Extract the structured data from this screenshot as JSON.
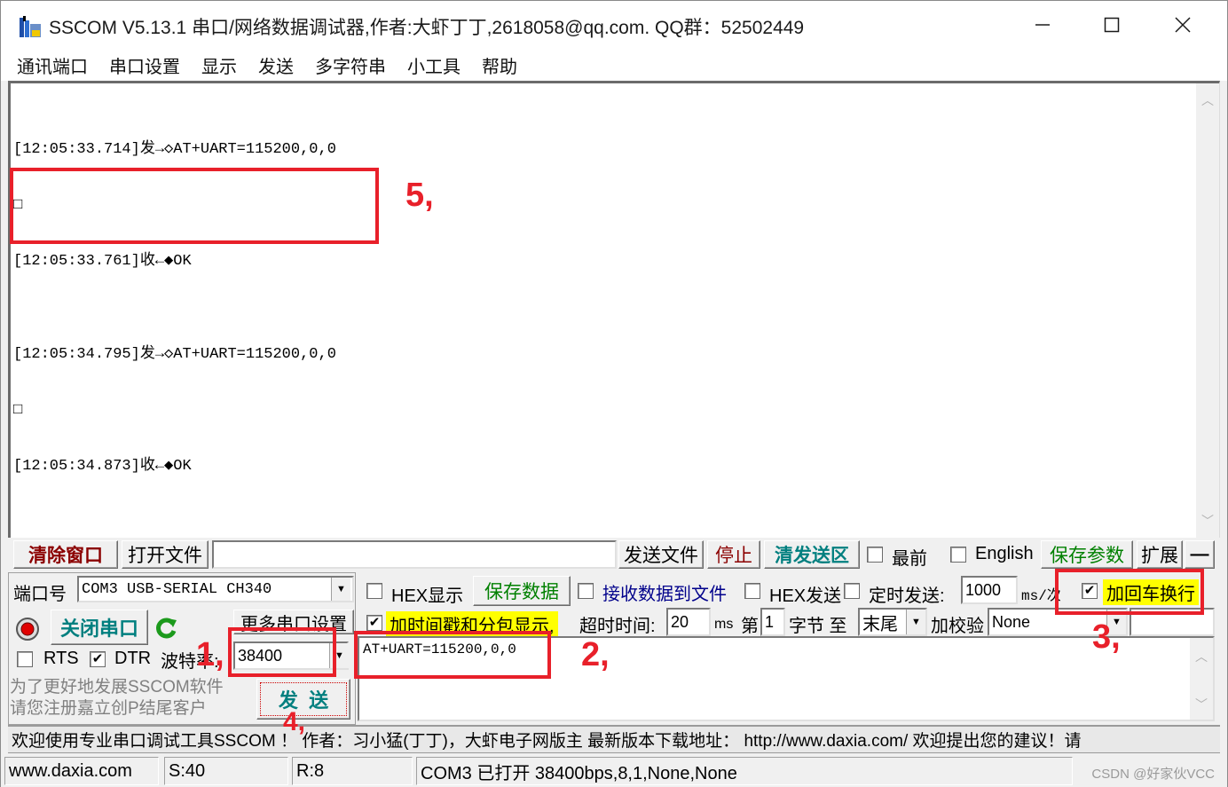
{
  "window": {
    "title": "SSCOM V5.13.1 串口/网络数据调试器,作者:大虾丁丁,2618058@qq.com. QQ群：52502449",
    "controls": {
      "minimize": "—",
      "maximize": "☐",
      "close": "✕"
    }
  },
  "menubar": {
    "items": [
      "通讯端口",
      "串口设置",
      "显示",
      "发送",
      "多字符串",
      "小工具",
      "帮助"
    ]
  },
  "receive": {
    "lines": [
      "[12:05:33.714]发→◇AT+UART=115200,0,0",
      "□",
      "[12:05:33.761]收←◆OK",
      "",
      "[12:05:34.795]发→◇AT+UART=115200,0,0",
      "□",
      "[12:05:34.873]收←◆OK"
    ]
  },
  "toolbar": {
    "clear_window": "清除窗口",
    "open_file": "打开文件",
    "file_path": "",
    "send_file": "发送文件",
    "stop": "停止",
    "clear_send": "清发送区",
    "topmost": "最前",
    "topmost_checked": false,
    "english": "English",
    "english_checked": false,
    "save_params": "保存参数",
    "expand": "扩展",
    "collapse": "—"
  },
  "port": {
    "port_label": "端口号",
    "port_value": "COM3 USB-SERIAL CH340",
    "close_port": "关闭串口",
    "more_settings": "更多串口设置",
    "rts_label": "RTS",
    "rts_checked": false,
    "dtr_label": "DTR",
    "dtr_checked": true,
    "baud_label": "波特率:",
    "baud_value": "38400",
    "promo_line1": "为了更好地发展SSCOM软件",
    "promo_line2": "请您注册嘉立创P结尾客户",
    "send_button": "发  送"
  },
  "options": {
    "hex_display": "HEX显示",
    "hex_display_checked": false,
    "save_data": "保存数据",
    "recv_to_file": "接收数据到文件",
    "recv_to_file_checked": false,
    "hex_send": "HEX发送",
    "hex_send_checked": false,
    "timed_send": "定时发送:",
    "timed_send_checked": false,
    "interval_value": "1000",
    "interval_unit": "ms/次",
    "add_crlf": "加回车换行",
    "add_crlf_checked": true,
    "timestamp": "加时间戳和分包显示,",
    "timestamp_checked": true,
    "timeout_label": "超时时间:",
    "timeout_value": "20",
    "timeout_unit": "ms",
    "byte_from_label": "第",
    "byte_from_value": "1",
    "byte_unit": "字节 至",
    "byte_to_value": "末尾",
    "checksum_label": "加校验",
    "checksum_value": "None"
  },
  "send_area": {
    "text": "AT+UART=115200,0,0"
  },
  "ticker": "欢迎使用专业串口调试工具SSCOM ！ 作者：习小猛(丁丁)，大虾电子网版主  最新版本下载地址： http://www.daxia.com/  欢迎提出您的建议！请",
  "statusbar": {
    "website": "www.daxia.com",
    "sent": "S:40",
    "received": "R:8",
    "port_status": "COM3 已打开  38400bps,8,1,None,None"
  },
  "annotations": [
    "1,",
    "2,",
    "3,",
    "4,",
    "5,"
  ],
  "watermark": "CSDN @好家伙VCC",
  "colors": {
    "annotation_red": "#e8202a",
    "highlight_yellow": "#ffff00",
    "clear_window_text": "#8b0000",
    "teal_text": "#007f7f",
    "green_text": "#008000",
    "blue_text": "#00008b"
  }
}
